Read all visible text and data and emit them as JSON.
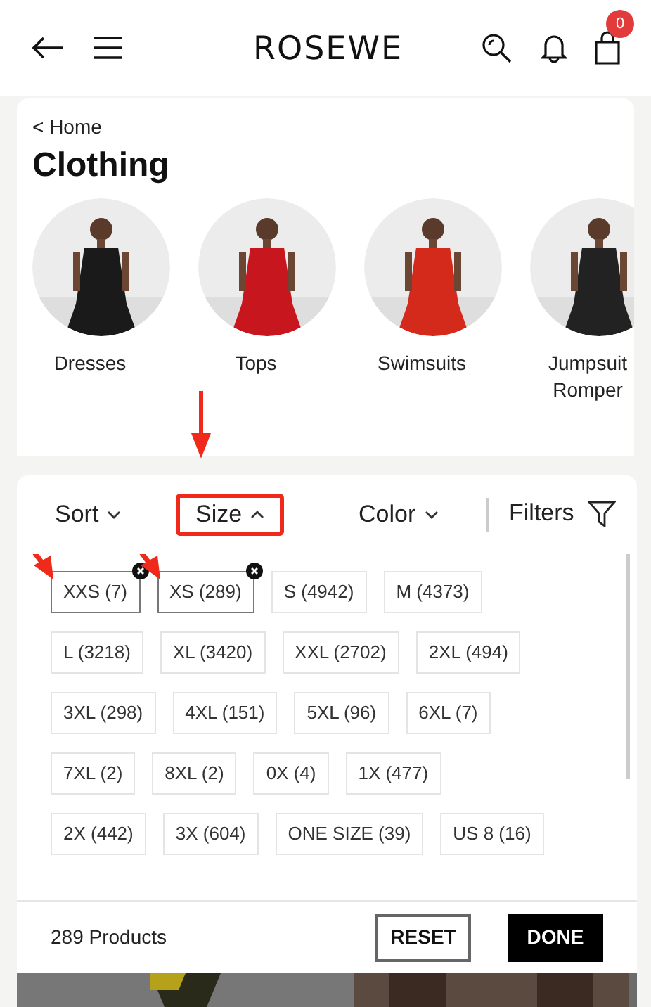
{
  "header": {
    "logo": "ROSEWE",
    "cart_count": "0"
  },
  "breadcrumb": "< Home",
  "title": "Clothing",
  "categories": [
    {
      "label": "Dresses"
    },
    {
      "label": "Tops"
    },
    {
      "label": "Swimsuits"
    },
    {
      "label": "Jumpsuit\nRomper"
    }
  ],
  "filter_tabs": [
    {
      "label": "Sort",
      "expanded": false,
      "annotated": false
    },
    {
      "label": "Size",
      "expanded": true,
      "annotated": true
    },
    {
      "label": "Color",
      "expanded": false,
      "annotated": false
    }
  ],
  "filters_button": "Filters",
  "sizes": [
    {
      "label": "XXS (7)",
      "selected": true,
      "annotated": true
    },
    {
      "label": "XS (289)",
      "selected": true,
      "annotated": true
    },
    {
      "label": "S (4942)",
      "selected": false,
      "annotated": false
    },
    {
      "label": "M (4373)",
      "selected": false,
      "annotated": false
    },
    {
      "label": "L (3218)",
      "selected": false,
      "annotated": false
    },
    {
      "label": "XL (3420)",
      "selected": false,
      "annotated": false
    },
    {
      "label": "XXL (2702)",
      "selected": false,
      "annotated": false
    },
    {
      "label": "2XL (494)",
      "selected": false,
      "annotated": false
    },
    {
      "label": "3XL (298)",
      "selected": false,
      "annotated": false
    },
    {
      "label": "4XL (151)",
      "selected": false,
      "annotated": false
    },
    {
      "label": "5XL (96)",
      "selected": false,
      "annotated": false
    },
    {
      "label": "6XL (7)",
      "selected": false,
      "annotated": false
    },
    {
      "label": "7XL (2)",
      "selected": false,
      "annotated": false
    },
    {
      "label": "8XL (2)",
      "selected": false,
      "annotated": false
    },
    {
      "label": "0X (4)",
      "selected": false,
      "annotated": false
    },
    {
      "label": "1X (477)",
      "selected": false,
      "annotated": false
    },
    {
      "label": "2X (442)",
      "selected": false,
      "annotated": false
    },
    {
      "label": "3X (604)",
      "selected": false,
      "annotated": false
    },
    {
      "label": "ONE SIZE (39)",
      "selected": false,
      "annotated": false
    },
    {
      "label": "US 8 (16)",
      "selected": false,
      "annotated": false
    }
  ],
  "footer": {
    "count": "289 Products",
    "reset": "RESET",
    "done": "DONE"
  }
}
